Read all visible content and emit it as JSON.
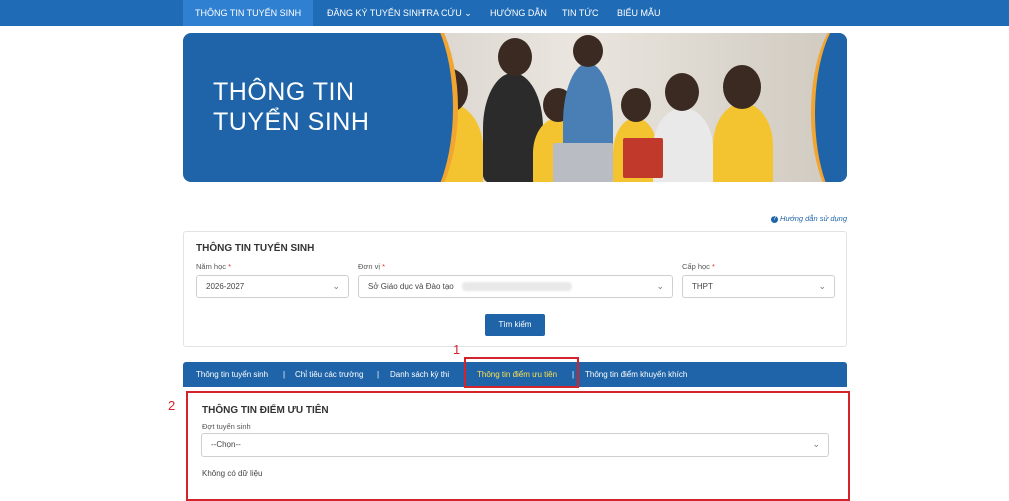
{
  "nav": {
    "items": [
      {
        "label": "THÔNG TIN TUYỂN SINH",
        "active": true
      },
      {
        "label": "ĐĂNG KÝ TUYỂN SINH",
        "active": false
      },
      {
        "label": "TRA CỨU ⌄",
        "active": false
      },
      {
        "label": "HƯỚNG DẪN",
        "active": false
      },
      {
        "label": "TIN TỨC",
        "active": false
      },
      {
        "label": "BIỂU MẪU",
        "active": false
      }
    ]
  },
  "banner": {
    "title_line1": "THÔNG TIN",
    "title_line2": "TUYỂN SINH"
  },
  "help": {
    "icon": "question-circle-icon",
    "label": "Hướng dẫn sử dụng"
  },
  "search": {
    "title": "THÔNG TIN TUYỂN SINH",
    "year": {
      "label": "Năm học",
      "required": "*",
      "value": "2026-2027"
    },
    "unit": {
      "label": "Đơn vị",
      "required": "*",
      "value": "Sở Giáo dục và Đào tạo"
    },
    "level": {
      "label": "Cấp học",
      "required": "*",
      "value": "THPT"
    },
    "chevron": "⌄",
    "button_label": "Tìm kiếm"
  },
  "tabs": {
    "items": [
      {
        "label": "Thông tin tuyển sinh",
        "active": false
      },
      {
        "label": "Chỉ tiêu các trường",
        "active": false
      },
      {
        "label": "Danh sách kỳ thi",
        "active": false
      },
      {
        "label": "Thông tin điểm ưu tiên",
        "active": true
      },
      {
        "label": "Thông tin điểm khuyến khích",
        "active": false
      }
    ],
    "separator": "|"
  },
  "annotations": {
    "marker1": "1",
    "marker2": "2",
    "color": "#d4232a"
  },
  "priority": {
    "title": "THÔNG TIN ĐIỂM ƯU TIÊN",
    "round_label": "Đợt tuyển sinh",
    "round_placeholder": "--Chọn--",
    "empty_text": "Không có dữ liệu"
  },
  "colors": {
    "primary": "#1f64a8",
    "accent": "#f2a531",
    "active_tab": "#ffe14a"
  }
}
